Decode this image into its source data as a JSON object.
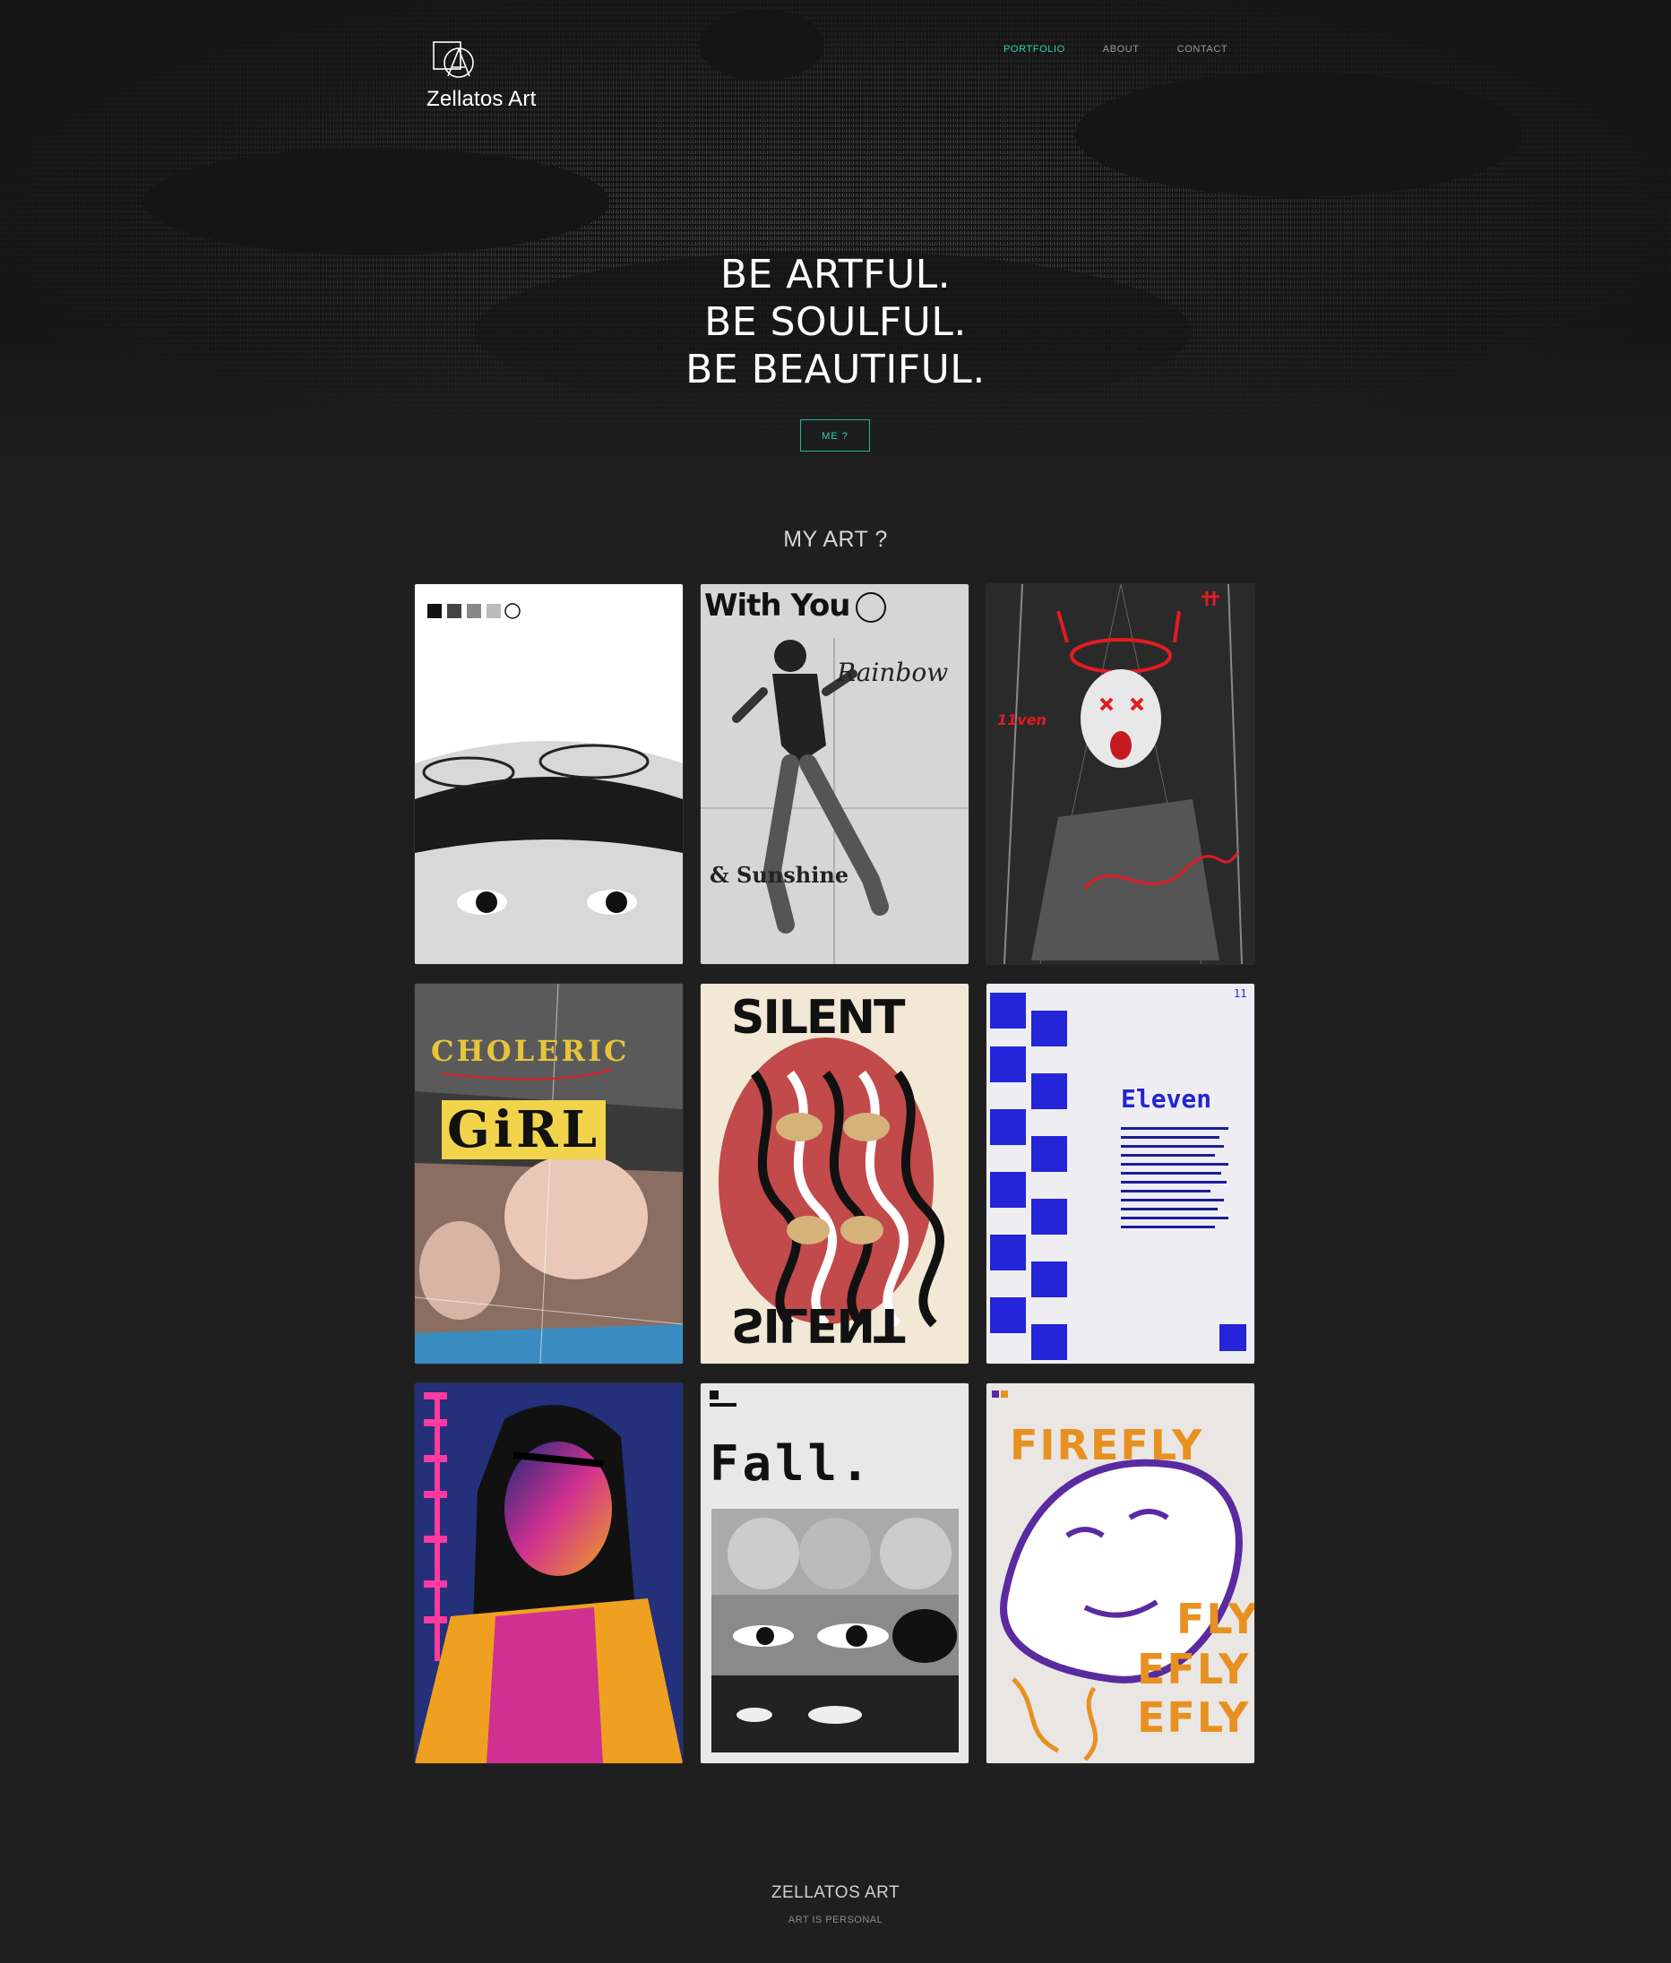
{
  "brand": {
    "logo_icon": "zellatos-monogram-icon",
    "name": "Zellatos Art"
  },
  "nav": {
    "items": [
      {
        "label": "PORTFOLIO",
        "active": true
      },
      {
        "label": "ABOUT",
        "active": false
      },
      {
        "label": "CONTACT",
        "active": false
      }
    ]
  },
  "hero": {
    "lines": [
      "BE ARTFUL.",
      "BE SOULFUL.",
      "BE BEAUTIFUL."
    ],
    "button_label": "ME ?"
  },
  "gallery": {
    "title": "MY ART ?",
    "items": [
      {
        "name": "goggles-girl-poster",
        "text": []
      },
      {
        "name": "with-you-poster",
        "text": [
          "With You",
          "Rainbow",
          "& Sunshine"
        ]
      },
      {
        "name": "eleven-red-graffiti-poster",
        "text": [
          "11ven"
        ]
      },
      {
        "name": "choleric-girl-poster",
        "text": [
          "CHOLERIC",
          "GiRL"
        ]
      },
      {
        "name": "silent-poster",
        "text": [
          "SILENT",
          "SILENT"
        ]
      },
      {
        "name": "eleven-blue-poster",
        "text": [
          "Eleven",
          "11"
        ]
      },
      {
        "name": "neon-girl-poster",
        "text": []
      },
      {
        "name": "fall-poster",
        "text": [
          "Fall."
        ]
      },
      {
        "name": "firefly-poster",
        "text": [
          "FIREFLY",
          "FLY",
          "EFLY",
          "EFLY"
        ]
      }
    ]
  },
  "footer": {
    "title": "ZELLATOS ART",
    "subtitle": "ART IS PERSONAL"
  },
  "colors": {
    "accent": "#2bd1b0",
    "background": "#1f1f1f",
    "text": "#ffffff"
  }
}
